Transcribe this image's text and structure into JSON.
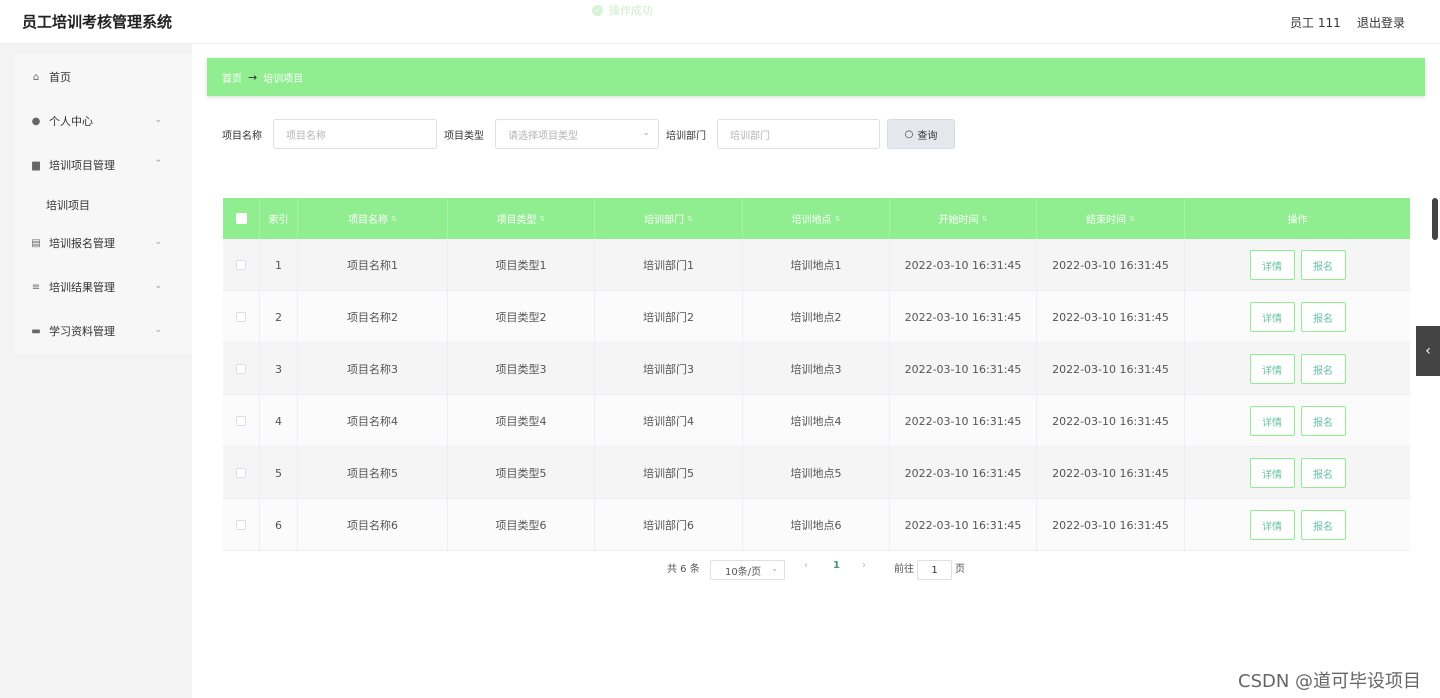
{
  "app": {
    "title": "员工培训考核管理系统"
  },
  "toast": {
    "text": "操作成功"
  },
  "topbar": {
    "user": "员工 111",
    "logout": "退出登录"
  },
  "sidebar": {
    "items": [
      {
        "label": "首页",
        "icon": "home-icon"
      },
      {
        "label": "个人中心",
        "icon": "user-icon"
      },
      {
        "label": "培训项目管理",
        "icon": "briefcase-icon"
      },
      {
        "label": "培训报名管理",
        "icon": "clipboard-icon"
      },
      {
        "label": "培训结果管理",
        "icon": "list-icon"
      },
      {
        "label": "学习资料管理",
        "icon": "monitor-icon"
      }
    ],
    "subitem": "培训项目"
  },
  "breadcrumb": {
    "home": "首页",
    "arrow": "→",
    "current": "培训项目"
  },
  "filters": {
    "name_label": "项目名称",
    "name_placeholder": "项目名称",
    "type_label": "项目类型",
    "type_placeholder": "请选择项目类型",
    "dept_label": "培训部门",
    "dept_placeholder": "培训部门",
    "query_label": "查询"
  },
  "table": {
    "headers": [
      "索引",
      "项目名称",
      "项目类型",
      "培训部门",
      "培训地点",
      "开始时间",
      "结束时间",
      "操作"
    ],
    "rows": [
      {
        "index": "1",
        "name": "项目名称1",
        "type": "项目类型1",
        "dept": "培训部门1",
        "place": "培训地点1",
        "start": "2022-03-10 16:31:45",
        "end": "2022-03-10 16:31:45"
      },
      {
        "index": "2",
        "name": "项目名称2",
        "type": "项目类型2",
        "dept": "培训部门2",
        "place": "培训地点2",
        "start": "2022-03-10 16:31:45",
        "end": "2022-03-10 16:31:45"
      },
      {
        "index": "3",
        "name": "项目名称3",
        "type": "项目类型3",
        "dept": "培训部门3",
        "place": "培训地点3",
        "start": "2022-03-10 16:31:45",
        "end": "2022-03-10 16:31:45"
      },
      {
        "index": "4",
        "name": "项目名称4",
        "type": "项目类型4",
        "dept": "培训部门4",
        "place": "培训地点4",
        "start": "2022-03-10 16:31:45",
        "end": "2022-03-10 16:31:45"
      },
      {
        "index": "5",
        "name": "项目名称5",
        "type": "项目类型5",
        "dept": "培训部门5",
        "place": "培训地点5",
        "start": "2022-03-10 16:31:45",
        "end": "2022-03-10 16:31:45"
      },
      {
        "index": "6",
        "name": "项目名称6",
        "type": "项目类型6",
        "dept": "培训部门6",
        "place": "培训地点6",
        "start": "2022-03-10 16:31:45",
        "end": "2022-03-10 16:31:45"
      }
    ],
    "actions": {
      "detail": "详情",
      "apply": "报名"
    }
  },
  "pagination": {
    "total": "共 6 条",
    "page_size": "10条/页",
    "current_page": "1",
    "goto_label": "前往",
    "goto_value": "1",
    "page_suffix": "页"
  },
  "watermark": "CSDN @道可毕设项目",
  "colors": {
    "accent": "#90ee90",
    "button_text": "#67c2a4",
    "page_active": "#3a9a7a"
  }
}
